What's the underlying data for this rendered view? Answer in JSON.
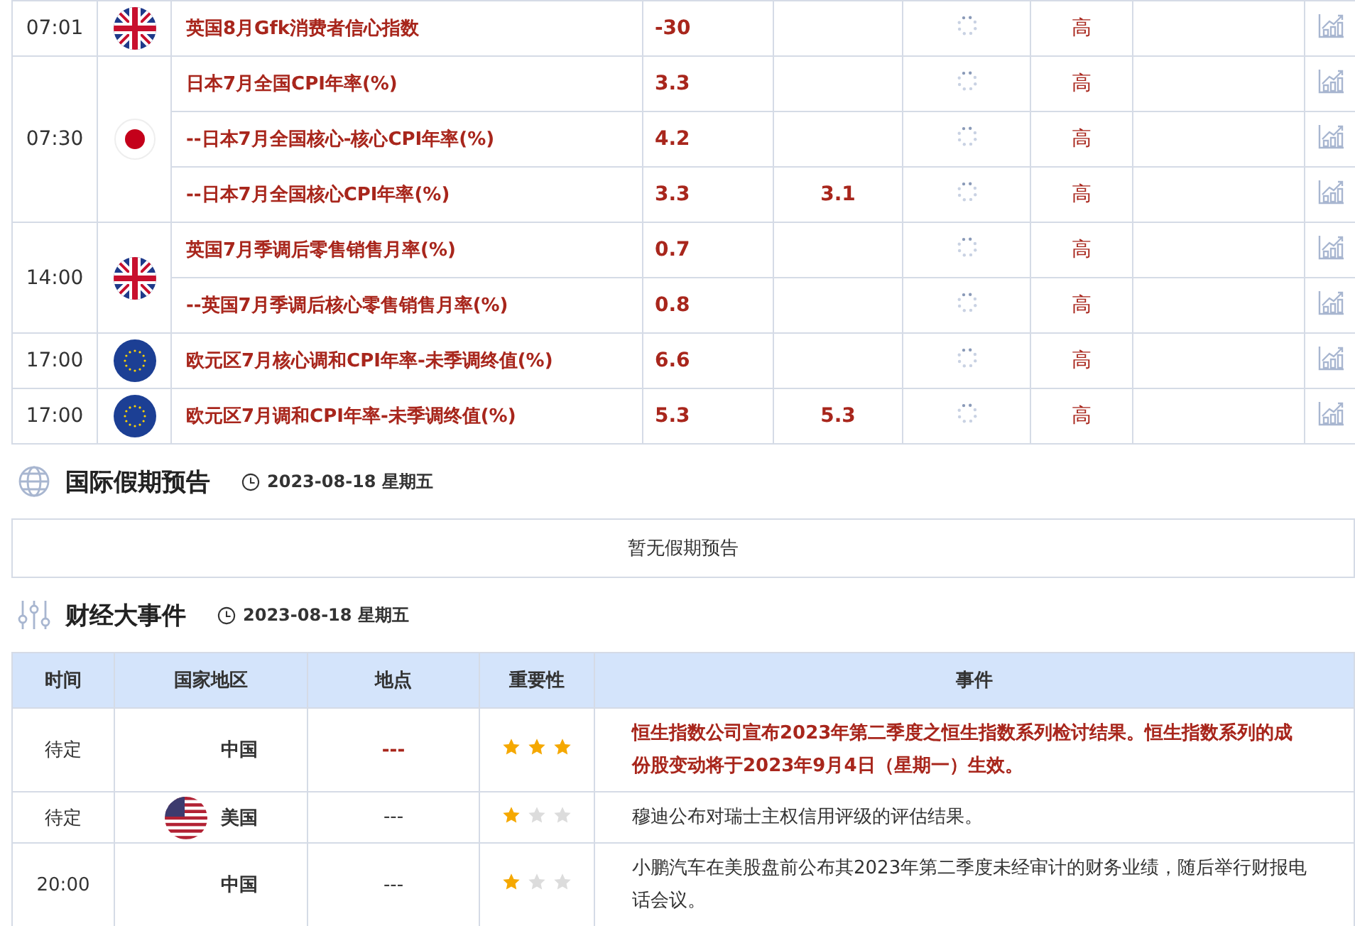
{
  "data_table": {
    "groups": [
      {
        "time": "07:01",
        "kind": "uk",
        "rows": [
          {
            "name": "英国8月Gfk消费者信心指数",
            "previous": "-30",
            "forecast": "",
            "importance": "高",
            "important": true
          }
        ]
      },
      {
        "time": "07:30",
        "kind": "jp",
        "rows": [
          {
            "name": "日本7月全国CPI年率(%)",
            "previous": "3.3",
            "forecast": "",
            "importance": "高",
            "important": true
          },
          {
            "name": "--日本7月全国核心-核心CPI年率(%)",
            "previous": "4.2",
            "forecast": "",
            "importance": "高",
            "important": true
          },
          {
            "name": "--日本7月全国核心CPI年率(%)",
            "previous": "3.3",
            "forecast": "3.1",
            "importance": "高",
            "important": true
          }
        ]
      },
      {
        "time": "14:00",
        "kind": "uk",
        "rows": [
          {
            "name": "英国7月季调后零售销售月率(%)",
            "previous": "0.7",
            "forecast": "",
            "importance": "高",
            "important": true
          },
          {
            "name": "--英国7月季调后核心零售销售月率(%)",
            "previous": "0.8",
            "forecast": "",
            "importance": "高",
            "important": true
          }
        ]
      },
      {
        "time": "17:00",
        "kind": "eu",
        "rows": [
          {
            "name": "欧元区7月核心调和CPI年率-未季调终值(%)",
            "previous": "6.6",
            "forecast": "",
            "importance": "高",
            "important": true
          }
        ]
      },
      {
        "time": "17:00",
        "kind": "eu",
        "rows": [
          {
            "name": "欧元区7月调和CPI年率-未季调终值(%)",
            "previous": "5.3",
            "forecast": "5.3",
            "importance": "高",
            "important": true
          }
        ]
      }
    ]
  },
  "holiday_section": {
    "title": "国际假期预告",
    "date": "2023-08-18 星期五",
    "empty_message": "暂无假期预告"
  },
  "events_section": {
    "title": "财经大事件",
    "date": "2023-08-18 星期五",
    "columns": [
      "时间",
      "国家地区",
      "地点",
      "重要性",
      "事件"
    ],
    "rows": [
      {
        "time": "待定",
        "country": "中国",
        "location": "---",
        "stars": 3,
        "event": "恒生指数公司宣布2023年第二季度之恒生指数系列检讨结果。恒生指数系列的成份股变动将于2023年9月4日（星期一）生效。",
        "important": true
      },
      {
        "time": "待定",
        "kind": "us",
        "country": "美国",
        "location": "---",
        "stars": 1,
        "event": "穆迪公布对瑞士主权信用评级的评估结果。",
        "important": false
      },
      {
        "time": "20:00",
        "country": "中国",
        "location": "---",
        "stars": 1,
        "event": "小鹏汽车在美股盘前公布其2023年第二季度未经审计的财务业绩，随后举行财报电话会议。",
        "important": false
      }
    ]
  }
}
